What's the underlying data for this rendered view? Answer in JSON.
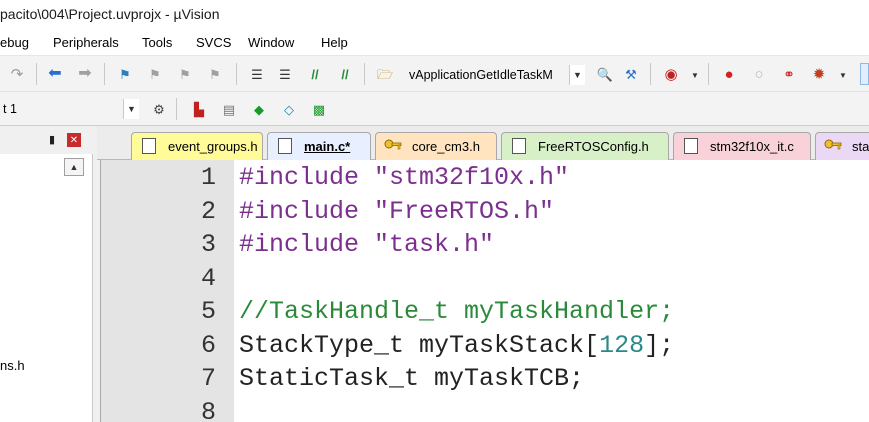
{
  "window": {
    "title": "pacito\\004\\Project.uvprojx - µVision"
  },
  "menu": {
    "items": [
      "ebug",
      "Peripherals",
      "Tools",
      "SVCS",
      "Window",
      "Help"
    ]
  },
  "toolbar": {
    "function_combo": "vApplicationGetIdleTaskM",
    "target_combo": "t 1"
  },
  "left_panel": {
    "pin_glyph": "ᵖ",
    "close_glyph": "✕",
    "file_label": "ns.h"
  },
  "tabs": [
    {
      "label": "event_groups.h",
      "color": "#fffb99",
      "active": false,
      "icon": "file-icon"
    },
    {
      "label": "main.c*",
      "color": "#e8f0ff",
      "active": true,
      "icon": "file-icon"
    },
    {
      "label": "core_cm3.h",
      "color": "#ffe4bf",
      "active": false,
      "icon": "key-file-icon"
    },
    {
      "label": "FreeRTOSConfig.h",
      "color": "#d8f0c8",
      "active": false,
      "icon": "file-icon"
    },
    {
      "label": "stm32f10x_it.c",
      "color": "#f8d2d8",
      "active": false,
      "icon": "file-icon"
    },
    {
      "label": "sta",
      "color": "#ead8f4",
      "active": false,
      "icon": "key-file-icon"
    }
  ],
  "editor": {
    "lines": [
      {
        "n": "1",
        "segs": [
          {
            "t": "#include \"stm32f10x.h\"",
            "c": "kw"
          }
        ]
      },
      {
        "n": "2",
        "segs": [
          {
            "t": "#include \"FreeRTOS.h\"",
            "c": "kw"
          }
        ]
      },
      {
        "n": "3",
        "segs": [
          {
            "t": "#include \"task.h\"",
            "c": "kw"
          }
        ]
      },
      {
        "n": "4",
        "segs": []
      },
      {
        "n": "5",
        "segs": [
          {
            "t": "//TaskHandle_t myTaskHandler;",
            "c": "cm"
          }
        ]
      },
      {
        "n": "6",
        "segs": [
          {
            "t": "StackType_t myTaskStack[",
            "c": "tx"
          },
          {
            "t": "128",
            "c": "num"
          },
          {
            "t": "];",
            "c": "tx"
          }
        ]
      },
      {
        "n": "7",
        "segs": [
          {
            "t": "StaticTask_t myTaskTCB;",
            "c": "tx"
          }
        ]
      },
      {
        "n": "8",
        "segs": []
      }
    ]
  }
}
